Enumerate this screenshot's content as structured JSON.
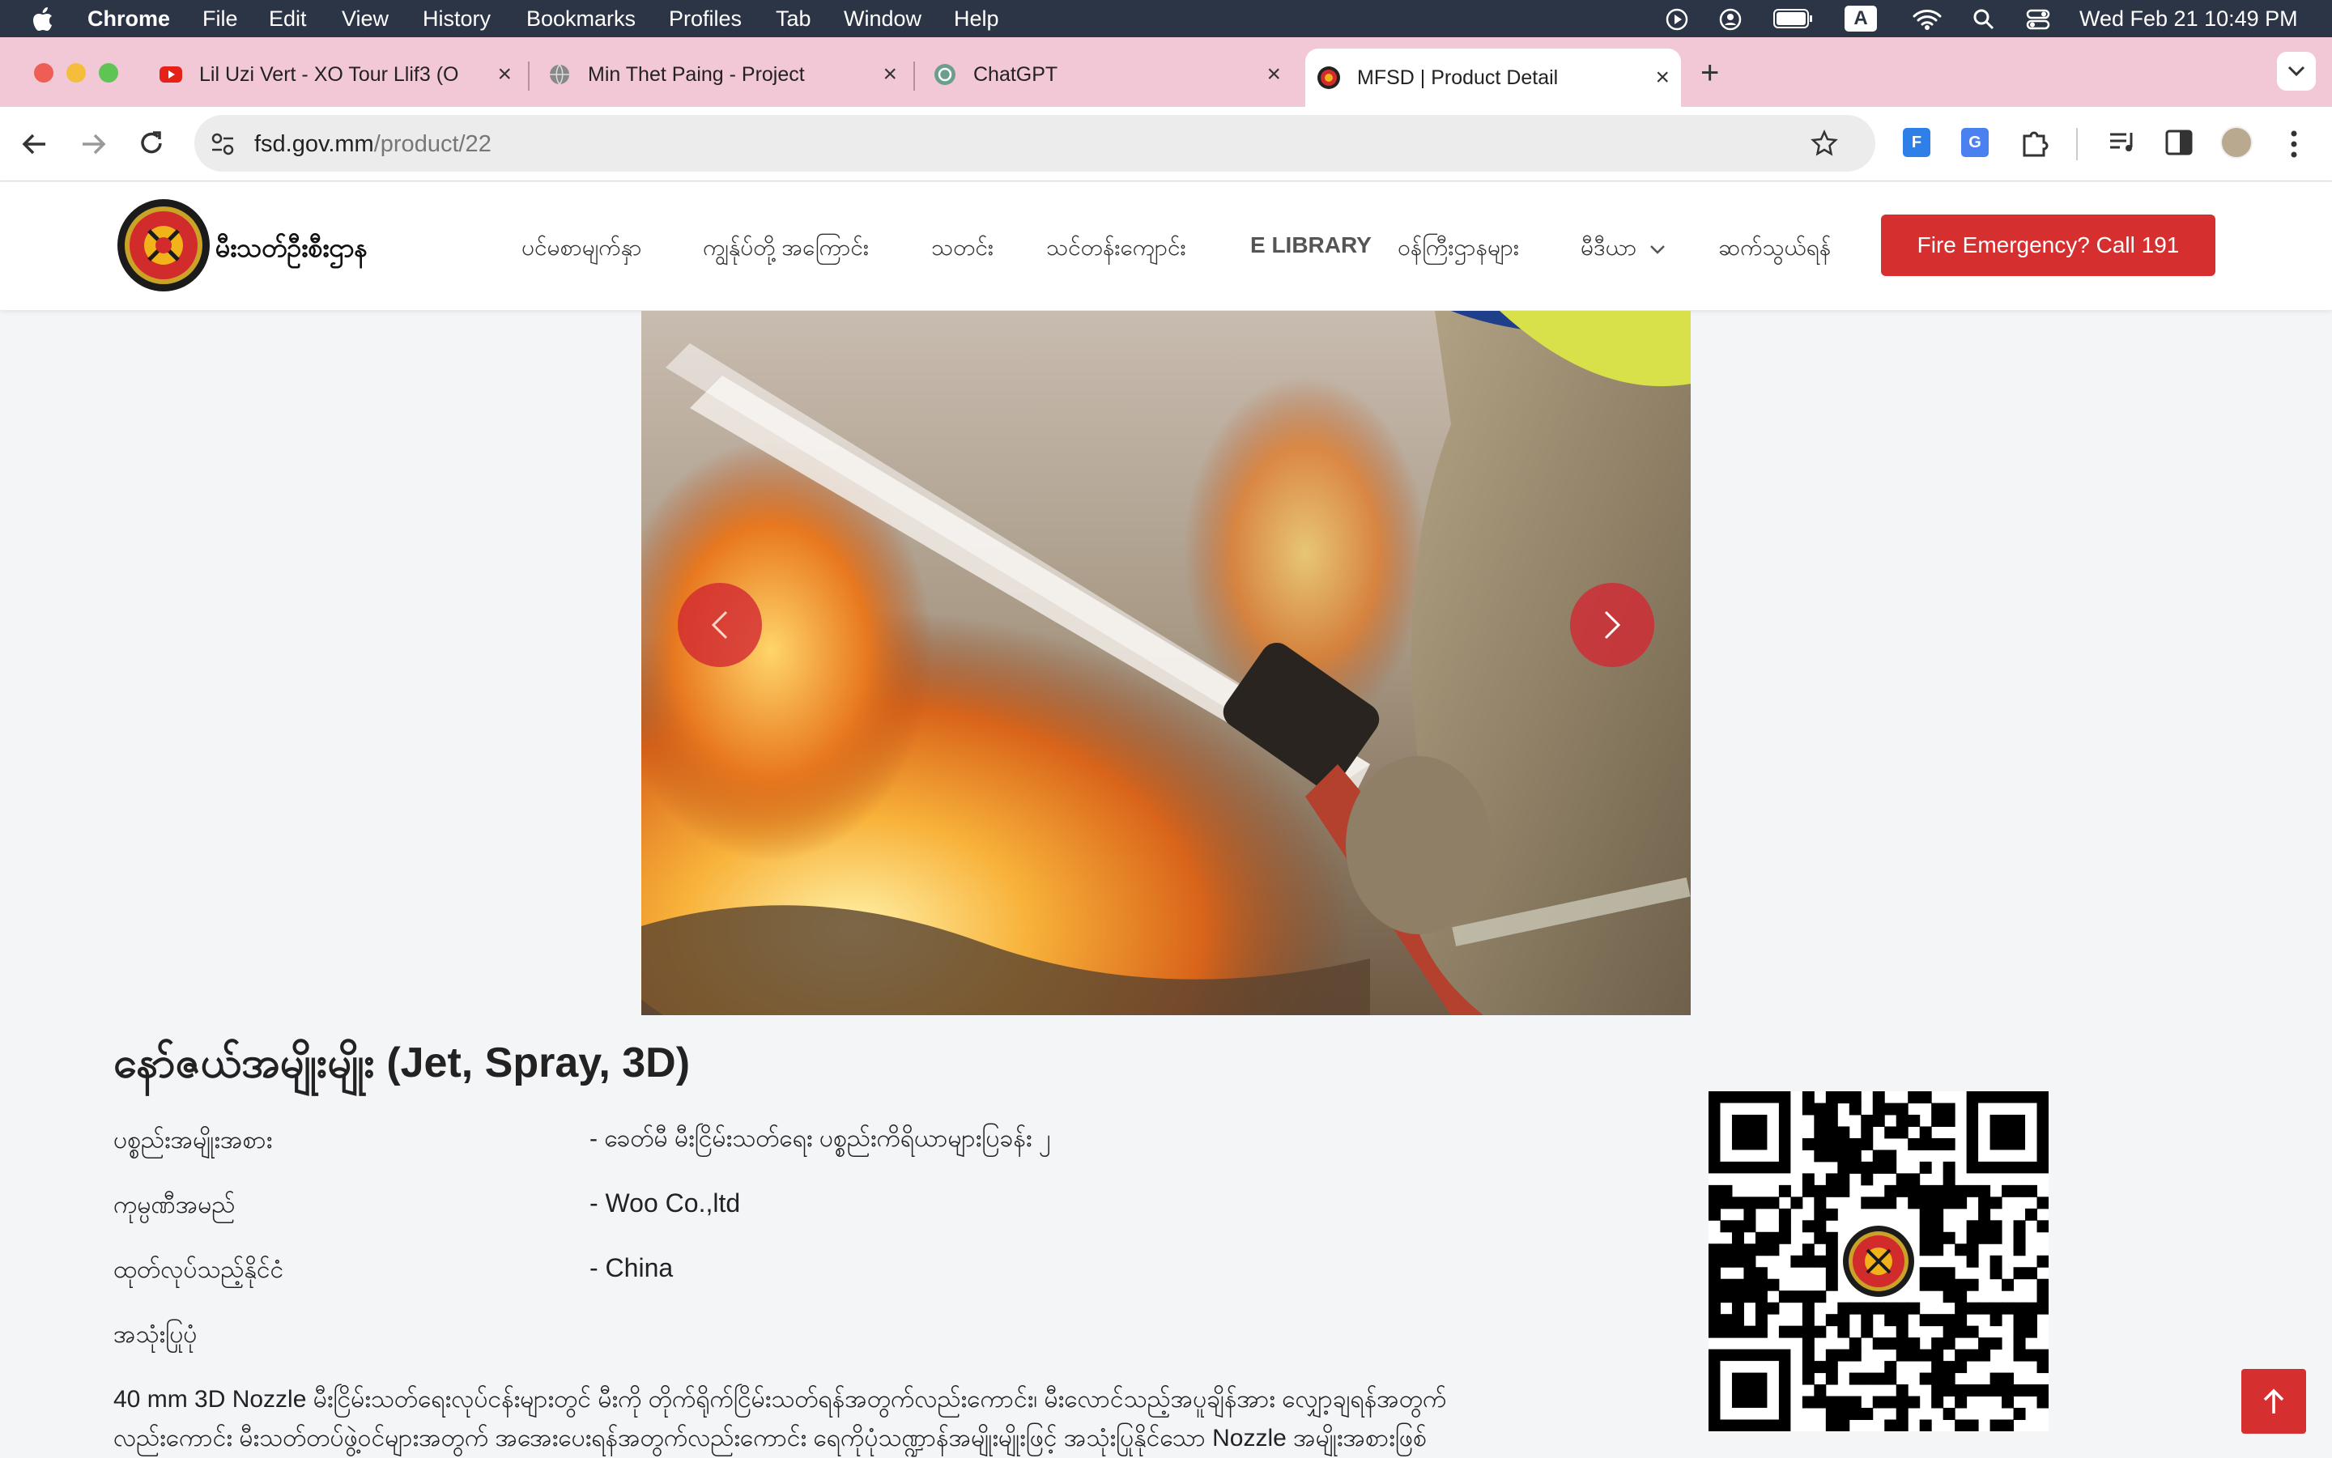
{
  "menubar": {
    "app": "Chrome",
    "items": [
      "File",
      "Edit",
      "View",
      "History",
      "Bookmarks",
      "Profiles",
      "Tab",
      "Window",
      "Help"
    ],
    "datetime": "Wed Feb 21  10:49 PM",
    "input_indicator": "A"
  },
  "tabs": [
    {
      "title": "Lil Uzi Vert - XO Tour Llif3 (O",
      "favicon": "youtube-icon"
    },
    {
      "title": "Min Thet Paing - Project",
      "favicon": "globe-icon"
    },
    {
      "title": "ChatGPT",
      "favicon": "chatgpt-icon"
    },
    {
      "title": "MFSD | Product Detail",
      "favicon": "mfsd-icon"
    }
  ],
  "address": {
    "domain": "fsd.gov.mm",
    "path": "/product/22"
  },
  "site": {
    "logo_text": "မီးသတ်ဦးစီးဌာန",
    "nav": [
      "ပင်မစာမျက်နှာ",
      "ကျွန်ုပ်တို့ အကြောင်း",
      "သတင်း",
      "သင်တန်းကျောင်း",
      "E LIBRARY",
      "ဝန်ကြီးဌာနများ",
      "မီဒီယာ",
      "ဆက်သွယ်ရန်"
    ],
    "cta": "Fire Emergency? Call 191"
  },
  "product": {
    "title": "နော်ဇယ်အမျိုးမျိုး (Jet, Spray, 3D)",
    "rows": [
      {
        "label": "ပစ္စည်းအမျိုးအစား",
        "value": "- ခေတ်မီ မီးငြိမ်းသတ်ရေး ပစ္စည်းကိရိယာများပြခန်း ၂"
      },
      {
        "label": "ကုမ္ပဏီအမည်",
        "value": "- Woo Co.,ltd"
      },
      {
        "label": "ထုတ်လုပ်သည့်နိုင်ငံ",
        "value": "- China"
      }
    ],
    "usage_label": "အသုံးပြုပုံ",
    "description_line1": "40 mm 3D Nozzle မီးငြိမ်းသတ်ရေးလုပ်ငန်းများတွင် မီးကို တိုက်ရိုက်ငြိမ်းသတ်ရန်အတွက်လည်းကောင်း၊ မီးလောင်သည့်အပူချိန်အား လျှော့ချရန်အတွက်",
    "description_line2": "လည်းကောင်း မီးသတ်တပ်ဖွဲ့ဝင်များအတွက် အအေးပေးရန်အတွက်လည်းကောင်း ရေကိုပုံသဏ္ဍာန်အမျိုးမျိုးဖြင့် အသုံးပြုနိုင်သော Nozzle အမျိုးအစားဖြစ်"
  }
}
